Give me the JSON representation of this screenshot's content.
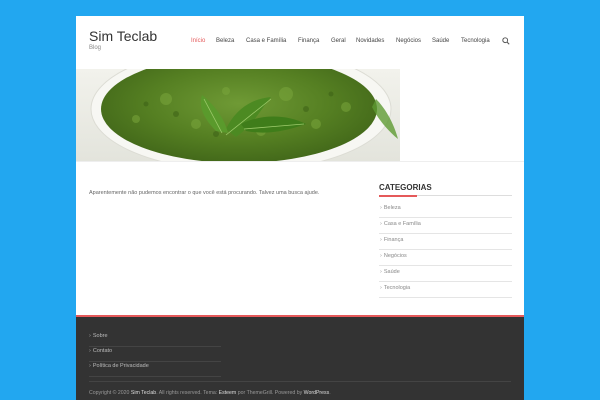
{
  "site": {
    "title": "Sim Teclab",
    "description": "Blog"
  },
  "nav": {
    "items": [
      {
        "label": "Início",
        "active": true
      },
      {
        "label": "Beleza",
        "active": false
      },
      {
        "label": "Casa e Família",
        "active": false
      },
      {
        "label": "Finança",
        "active": false
      },
      {
        "label": "Geral",
        "active": false
      },
      {
        "label": "Novidades",
        "active": false
      },
      {
        "label": "Negócios",
        "active": false
      },
      {
        "label": "Saúde",
        "active": false
      },
      {
        "label": "Tecnologia",
        "active": false
      }
    ],
    "search_icon": "search-icon"
  },
  "main": {
    "not_found_text": "Aparentemente não pudemos encontrar o que você está procurando. Talvez uma busca ajude."
  },
  "sidebar": {
    "widget_title": "CATEGORIAS",
    "categories": [
      "Beleza",
      "Casa e Família",
      "Finança",
      "Negócios",
      "Saúde",
      "Tecnologia"
    ]
  },
  "footer": {
    "links": [
      "Sobre",
      "Contato",
      "Política de Privacidade"
    ],
    "copyright_prefix": "Copyright © 2020",
    "copyright_site": "Sim Teclab",
    "copyright_rights": ". All rights reserved. Tema:",
    "theme_name": "Esteem",
    "theme_by": "por ThemeGrill. Powered by",
    "powered_by": "WordPress",
    "copyright_end": "."
  },
  "colors": {
    "background": "#22a7f0",
    "accent": "#e5595a",
    "footer_bg": "#333333"
  }
}
